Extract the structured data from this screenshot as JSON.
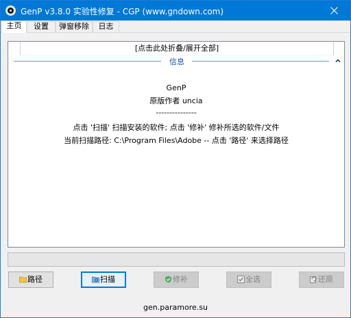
{
  "window": {
    "title": "GenP v3.8.0 实验性修复 - CGP (www.gndown.com)"
  },
  "tabs": [
    {
      "label": "主页",
      "active": true
    },
    {
      "label": "设置",
      "active": false
    },
    {
      "label": "弹窗移除",
      "active": false
    },
    {
      "label": "日志",
      "active": false
    }
  ],
  "log": {
    "collapse_label": "[点击此处折叠/展开全部]",
    "group_title": "信息",
    "lines": [
      "GenP",
      "原版作者 uncia",
      "---------------",
      "点击 '扫描' 扫描安装的软件; 点击 '修补' 修补所选的软件/文件",
      "当前扫描路径: C:\\Program Files\\Adobe -- 点击 '路径' 来选择路径"
    ]
  },
  "progress": {
    "value": 0
  },
  "buttons": {
    "path": "路径",
    "scan": "扫描",
    "patch": "修补",
    "select_all": "全选",
    "restore": "还原"
  },
  "footer": {
    "link": "gen.paramore.su"
  },
  "colors": {
    "titlebar": "#0078d7",
    "group_title": "#1a4fa3",
    "group_line": "#5b9bd5"
  },
  "icons": {
    "app": "app-logo-icon",
    "close": "close-icon",
    "collapse": "chevron-up-icon",
    "path": "folder-icon",
    "scan": "scan-icon",
    "patch": "shield-check-icon",
    "select_all": "checkbox-icon",
    "restore": "restore-icon"
  }
}
